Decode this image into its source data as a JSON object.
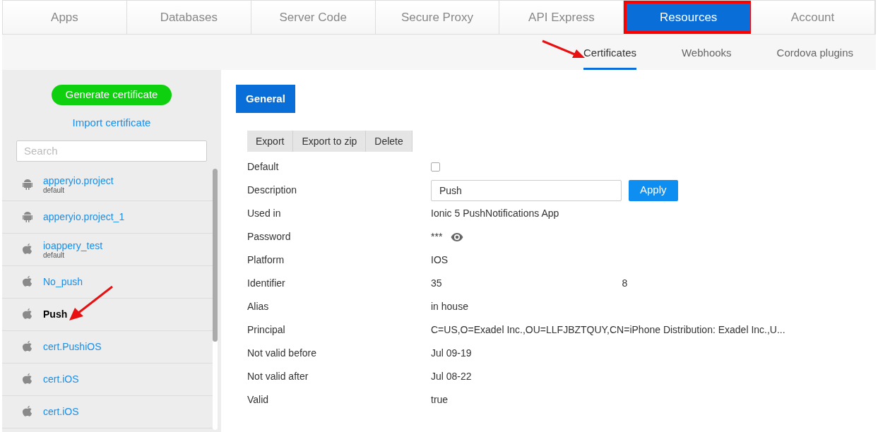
{
  "tabs": [
    {
      "label": "Apps",
      "selected": false,
      "highlighted": false
    },
    {
      "label": "Databases",
      "selected": false,
      "highlighted": false
    },
    {
      "label": "Server Code",
      "selected": false,
      "highlighted": false
    },
    {
      "label": "Secure Proxy",
      "selected": false,
      "highlighted": false
    },
    {
      "label": "API Express",
      "selected": false,
      "highlighted": false
    },
    {
      "label": "Resources",
      "selected": true,
      "highlighted": true
    },
    {
      "label": "Account",
      "selected": false,
      "highlighted": false
    }
  ],
  "subtabs": [
    {
      "label": "Certificates",
      "selected": true
    },
    {
      "label": "Webhooks",
      "selected": false
    },
    {
      "label": "Cordova plugins",
      "selected": false
    }
  ],
  "sidebar": {
    "generate_button": "Generate certificate",
    "import_link": "Import certificate",
    "search": {
      "placeholder": "Search"
    },
    "items": [
      {
        "kind": "android",
        "name": "apperyio.project",
        "note": "default",
        "selected": false
      },
      {
        "kind": "android",
        "name": "apperyio.project_1",
        "selected": false
      },
      {
        "kind": "apple",
        "name": "ioappery_test",
        "note": "default",
        "selected": false
      },
      {
        "kind": "apple",
        "name": "No_push",
        "selected": false
      },
      {
        "kind": "apple",
        "name": "Push",
        "selected": true
      },
      {
        "kind": "apple",
        "name": "cert.PushiOS",
        "selected": false
      },
      {
        "kind": "apple",
        "name": "cert.iOS",
        "selected": false
      },
      {
        "kind": "apple",
        "name": "cert.iOS",
        "selected": false
      }
    ]
  },
  "detail": {
    "tab": {
      "label": "General",
      "selected": true
    },
    "actions": [
      "Export",
      "Export to zip",
      "Delete"
    ],
    "fields": [
      {
        "kind": "checkbox",
        "label": "Default",
        "checked": false
      },
      {
        "kind": "input",
        "label": "Description",
        "value": "Push",
        "button": "Apply"
      },
      {
        "kind": "text",
        "label": "Used in",
        "value": "Ionic 5 PushNotifications App"
      },
      {
        "kind": "password",
        "label": "Password",
        "value": "***"
      },
      {
        "kind": "text",
        "label": "Platform",
        "value": "IOS"
      },
      {
        "kind": "redacted",
        "label": "Identifier",
        "start": "35",
        "end": "8"
      },
      {
        "kind": "text",
        "label": "Alias",
        "value": "in house"
      },
      {
        "kind": "text",
        "label": "Principal",
        "value": "C=US,O=Exadel Inc.,OU=LLFJBZTQUY,CN=iPhone Distribution: Exadel Inc.,U..."
      },
      {
        "kind": "text",
        "label": "Not valid before",
        "value": "Jul 09-19"
      },
      {
        "kind": "text",
        "label": "Not valid after",
        "value": "Jul 08-22"
      },
      {
        "kind": "text",
        "label": "Valid",
        "value": "true"
      }
    ]
  }
}
